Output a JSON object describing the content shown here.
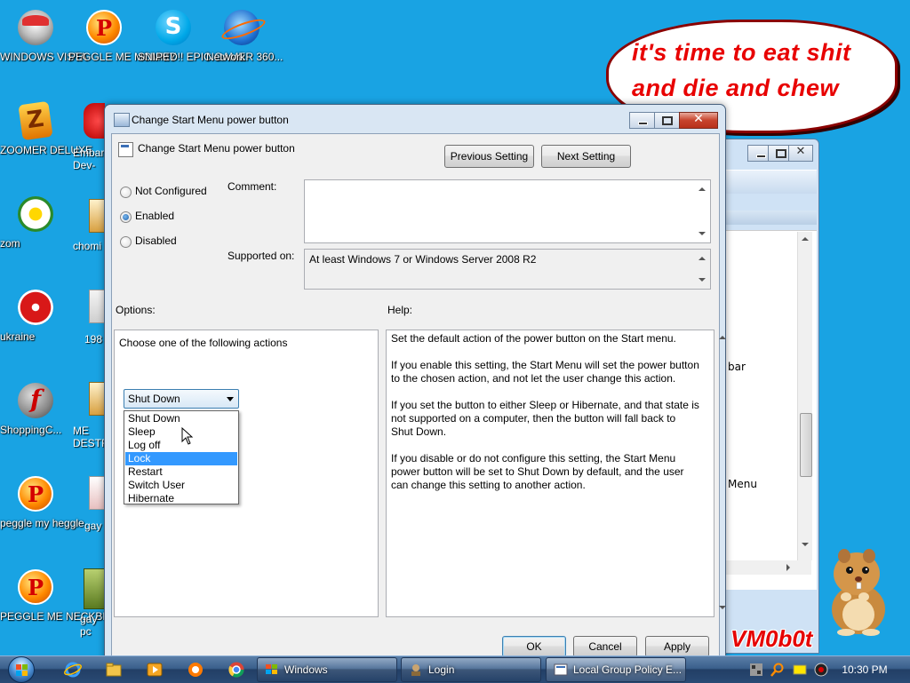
{
  "desktop": {
    "icons": [
      {
        "label": "WINDOWS VISTA",
        "icon": "vista-icon"
      },
      {
        "label": "PEGGLE ME MOMMY",
        "icon": "peggle-icon"
      },
      {
        "label": "SNIPED!! EPIC GAMER 360...",
        "icon": "skype-icon"
      },
      {
        "label": "Network",
        "icon": "network-icon"
      },
      {
        "label": "ZOOMER DELUXE",
        "icon": "zoomer-icon"
      },
      {
        "label": "Embar Dev-",
        "icon": "devcpp-icon"
      },
      {
        "label": "zom",
        "icon": "flower-icon"
      },
      {
        "label": "chomi",
        "icon": "app-icon"
      },
      {
        "label": "ukraine",
        "icon": "radiation-icon"
      },
      {
        "label": "198",
        "icon": "document-icon"
      },
      {
        "label": "ShoppingC...",
        "icon": "flash-icon"
      },
      {
        "label": "ME DESTR",
        "icon": "app-icon"
      },
      {
        "label": "peggle my heggle",
        "icon": "peggle-icon"
      },
      {
        "label": "gay",
        "icon": "document-icon"
      },
      {
        "label": "PEGGLE ME NECKBEA...",
        "icon": "peggle-icon"
      },
      {
        "label": "gay pc",
        "icon": "app-icon"
      }
    ],
    "speech_bubble": "it's time to eat shit and die and chew gum",
    "watermark": "VM0b0t"
  },
  "background_window": {
    "text_bar": "bar",
    "text_menu": "Menu"
  },
  "dialog": {
    "title": "Change Start Menu power button",
    "header_title": "Change Start Menu power button",
    "previous_setting": "Previous Setting",
    "next_setting": "Next Setting",
    "radio_not_configured": "Not Configured",
    "radio_enabled": "Enabled",
    "radio_disabled": "Disabled",
    "selected_state": "Enabled",
    "comment_label": "Comment:",
    "comment_value": "",
    "supported_on_label": "Supported on:",
    "supported_on_value": "At least Windows 7 or Windows Server 2008 R2",
    "options_label": "Options:",
    "help_label": "Help:",
    "choose_action_label": "Choose one of the following actions",
    "dropdown_value": "Shut Down",
    "dropdown_options": [
      "Shut Down",
      "Sleep",
      "Log off",
      "Lock",
      "Restart",
      "Switch User",
      "Hibernate"
    ],
    "dropdown_highlighted": "Lock",
    "help_paragraphs": [
      "Set the default action of the power button on the Start menu.",
      "If you enable this setting, the Start Menu will set the power button to the chosen action, and not let the user change this action.",
      "If you set the button to either Sleep or Hibernate, and that state is not supported on a computer, then the button will fall back to Shut Down.",
      "If you disable or do not configure this setting, the Start Menu power button will be set to Shut Down by default, and the user can change this setting to another action."
    ],
    "ok": "OK",
    "cancel": "Cancel",
    "apply": "Apply"
  },
  "taskbar": {
    "buttons": [
      {
        "label": "Windows",
        "icon": "windows-flag-icon"
      },
      {
        "label": "Login",
        "icon": "login-icon"
      },
      {
        "label": "Local Group Policy E...",
        "icon": "group-policy-icon"
      }
    ],
    "clock": "10:30 PM"
  },
  "colors": {
    "desktop": "#19a3e3",
    "bubble_text": "#e80000",
    "selection": "#3399ff"
  }
}
